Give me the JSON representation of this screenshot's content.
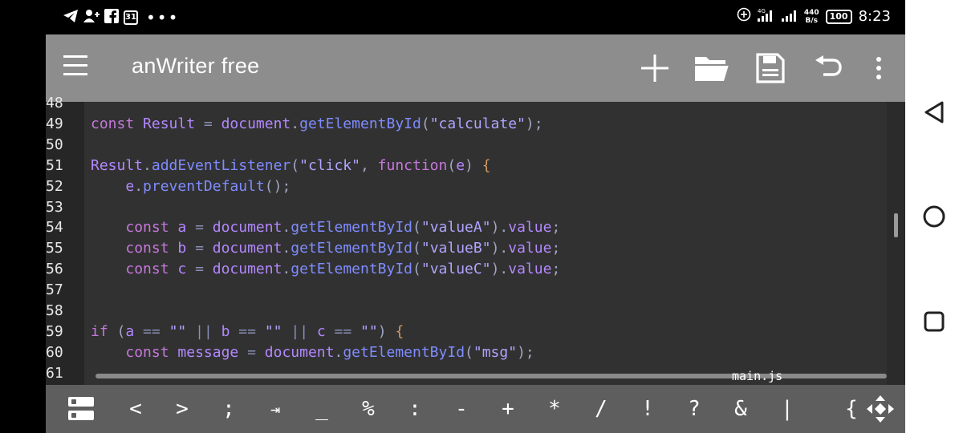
{
  "status_bar": {
    "calendar_day": "31",
    "net_type": "4G",
    "net_speed_value": "440",
    "net_speed_unit": "B/s",
    "battery": "100",
    "time": "8:23"
  },
  "toolbar": {
    "title": "anWriter free",
    "actions": [
      "plus-icon",
      "folder-icon",
      "save-icon",
      "undo-icon",
      "more-vertical-icon"
    ]
  },
  "editor": {
    "file_name": "main.js",
    "line_numbers": [
      "48",
      "49",
      "50",
      "51",
      "52",
      "53",
      "54",
      "55",
      "56",
      "57",
      "58",
      "59",
      "60",
      "61"
    ],
    "lines": [
      {
        "num": "49",
        "tokens": [
          [
            "kw",
            "const"
          ],
          [
            "",
            ""
          ],
          [
            "vr",
            "Result"
          ],
          [
            "op",
            " = "
          ],
          [
            "vr",
            "document"
          ],
          [
            "pu",
            "."
          ],
          [
            "fn",
            "getElementById"
          ],
          [
            "pu",
            "("
          ],
          [
            "st",
            "\"calculate\""
          ],
          [
            "pu",
            ");"
          ]
        ]
      },
      {
        "num": "51",
        "tokens": [
          [
            "vr",
            "Result"
          ],
          [
            "pu",
            "."
          ],
          [
            "fn",
            "addEventListener"
          ],
          [
            "pu",
            "("
          ],
          [
            "st",
            "\"click\""
          ],
          [
            "pu",
            ", "
          ],
          [
            "kw",
            "function"
          ],
          [
            "pu",
            "("
          ],
          [
            "vr",
            "e"
          ],
          [
            "pu",
            ") "
          ],
          [
            "ob",
            "{"
          ]
        ]
      },
      {
        "num": "52",
        "tokens": [
          [
            "",
            "    "
          ],
          [
            "vr",
            "e"
          ],
          [
            "pu",
            "."
          ],
          [
            "fn",
            "preventDefault"
          ],
          [
            "pu",
            "();"
          ]
        ]
      },
      {
        "num": "54",
        "tokens": [
          [
            "",
            "    "
          ],
          [
            "kw",
            "const"
          ],
          [
            "",
            ""
          ],
          [
            "vr",
            "a"
          ],
          [
            "op",
            " = "
          ],
          [
            "vr",
            "document"
          ],
          [
            "pu",
            "."
          ],
          [
            "fn",
            "getElementById"
          ],
          [
            "pu",
            "("
          ],
          [
            "st",
            "\"valueA\""
          ],
          [
            "pu",
            ")."
          ],
          [
            "vr",
            "value"
          ],
          [
            "pu",
            ";"
          ]
        ]
      },
      {
        "num": "55",
        "tokens": [
          [
            "",
            "    "
          ],
          [
            "kw",
            "const"
          ],
          [
            "",
            ""
          ],
          [
            "vr",
            "b"
          ],
          [
            "op",
            " = "
          ],
          [
            "vr",
            "document"
          ],
          [
            "pu",
            "."
          ],
          [
            "fn",
            "getElementById"
          ],
          [
            "pu",
            "("
          ],
          [
            "st",
            "\"valueB\""
          ],
          [
            "pu",
            ")."
          ],
          [
            "vr",
            "value"
          ],
          [
            "pu",
            ";"
          ]
        ]
      },
      {
        "num": "56",
        "tokens": [
          [
            "",
            "    "
          ],
          [
            "kw",
            "const"
          ],
          [
            "",
            ""
          ],
          [
            "vr",
            "c"
          ],
          [
            "op",
            " = "
          ],
          [
            "vr",
            "document"
          ],
          [
            "pu",
            "."
          ],
          [
            "fn",
            "getElementById"
          ],
          [
            "pu",
            "("
          ],
          [
            "st",
            "\"valueC\""
          ],
          [
            "pu",
            ")."
          ],
          [
            "vr",
            "value"
          ],
          [
            "pu",
            ";"
          ]
        ]
      },
      {
        "num": "59",
        "tokens": [
          [
            "kw",
            "if"
          ],
          [
            "pu",
            " ("
          ],
          [
            "vr",
            "a"
          ],
          [
            "op",
            " == "
          ],
          [
            "st",
            "\"\""
          ],
          [
            "op",
            " || "
          ],
          [
            "vr",
            "b"
          ],
          [
            "op",
            " == "
          ],
          [
            "st",
            "\"\""
          ],
          [
            "op",
            " || "
          ],
          [
            "vr",
            "c"
          ],
          [
            "op",
            " == "
          ],
          [
            "st",
            "\"\""
          ],
          [
            "pu",
            ") "
          ],
          [
            "ob",
            "{"
          ]
        ]
      },
      {
        "num": "60",
        "tokens": [
          [
            "",
            "    "
          ],
          [
            "kw",
            "const"
          ],
          [
            "",
            ""
          ],
          [
            "vr",
            "message"
          ],
          [
            "op",
            " = "
          ],
          [
            "vr",
            "document"
          ],
          [
            "pu",
            "."
          ],
          [
            "fn",
            "getElementById"
          ],
          [
            "pu",
            "("
          ],
          [
            "st",
            "\"msg\""
          ],
          [
            "pu",
            ");"
          ]
        ]
      }
    ]
  },
  "symbol_bar": {
    "keys": [
      "<",
      ">",
      ";",
      "⇥",
      "_",
      "%",
      ":",
      "-",
      "+",
      "*",
      "/",
      "!",
      "?",
      "&",
      "|",
      "{"
    ]
  },
  "nav_bar": {
    "buttons": [
      "back-icon",
      "home-icon",
      "recents-icon"
    ]
  }
}
